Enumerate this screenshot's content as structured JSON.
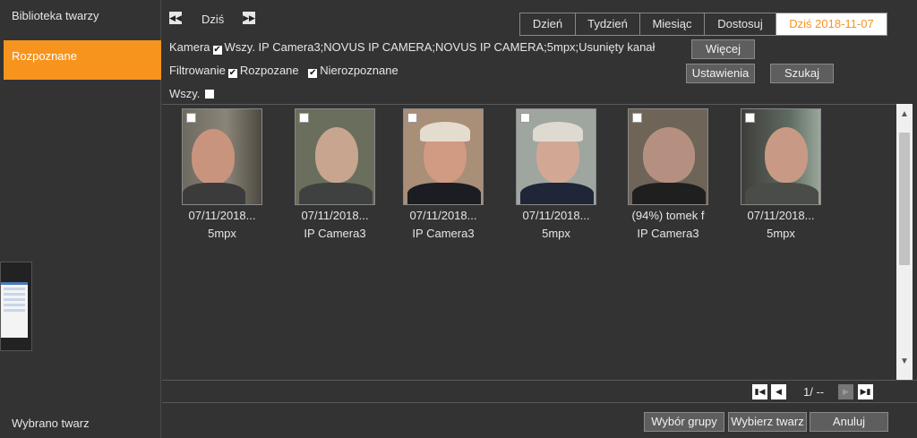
{
  "sidebar": {
    "items": [
      {
        "label": "Biblioteka twarzy",
        "active": false
      },
      {
        "label": "Rozpoznane",
        "active": true
      }
    ],
    "footer_label": "Wybrano twarz"
  },
  "nav": {
    "today_label": "Dziś"
  },
  "filters": {
    "camera_label": "Kamera",
    "camera_value": "Wszy. IP Camera3;NOVUS IP CAMERA;NOVUS IP CAMERA;5mpx;Usunięty kanał",
    "filter_label": "Filtrowanie",
    "recognized_label": "Rozpozane",
    "unrecognized_label": "Nierozpoznane",
    "all_label": "Wszy."
  },
  "tabs": [
    {
      "label": "Dzień"
    },
    {
      "label": "Tydzień"
    },
    {
      "label": "Miesiąc"
    },
    {
      "label": "Dostosuj"
    },
    {
      "label": "Dziś 2018-11-07"
    }
  ],
  "buttons": {
    "more": "Więcej",
    "settings": "Ustawienia",
    "search": "Szukaj",
    "group_select": "Wybór grupy",
    "choose_face": "Wybierz twarz",
    "cancel": "Anuluj"
  },
  "faces": [
    {
      "date": "07/11/2018...",
      "camera": "5mpx"
    },
    {
      "date": "07/11/2018...",
      "camera": "IP Camera3"
    },
    {
      "date": "07/11/2018...",
      "camera": "IP Camera3"
    },
    {
      "date": "07/11/2018...",
      "camera": "5mpx"
    },
    {
      "date": "(94%) tomek f",
      "camera": "IP Camera3"
    },
    {
      "date": "07/11/2018...",
      "camera": "5mpx"
    }
  ],
  "pager": {
    "page_text": "1/ --"
  },
  "colors": {
    "accent": "#f7941d",
    "background": "#333333"
  }
}
